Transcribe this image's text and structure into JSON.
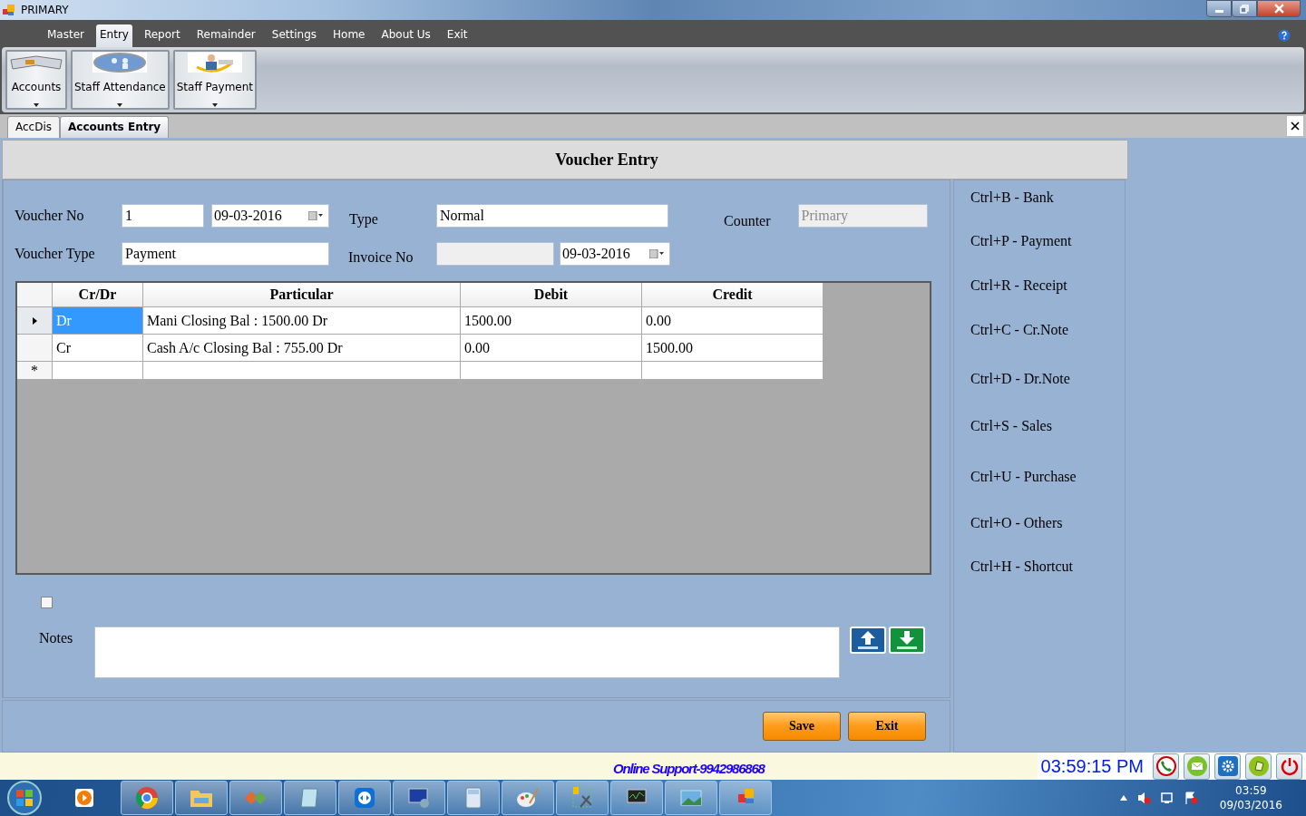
{
  "window": {
    "title": "PRIMARY"
  },
  "menu": [
    {
      "label": "Master",
      "selected": false
    },
    {
      "label": "Entry",
      "selected": true
    },
    {
      "label": "Report",
      "selected": false
    },
    {
      "label": "Remainder",
      "selected": false
    },
    {
      "label": "Settings",
      "selected": false
    },
    {
      "label": "Home",
      "selected": false
    },
    {
      "label": "About Us",
      "selected": false
    },
    {
      "label": "Exit",
      "selected": false
    }
  ],
  "ribbon": [
    {
      "label": "Accounts",
      "kind": "book"
    },
    {
      "label": "Staff Attendance",
      "kind": "people"
    },
    {
      "label": "Staff Payment",
      "kind": "worker"
    }
  ],
  "doc_tabs": [
    {
      "label": "AccDis",
      "selected": false
    },
    {
      "label": "Accounts Entry",
      "selected": true
    }
  ],
  "form": {
    "heading": "Voucher Entry",
    "voucher_no_label": "Voucher No",
    "voucher_no": "1",
    "voucher_date": "09-03-2016",
    "type_label": "Type",
    "type": "Normal",
    "counter_label": "Counter",
    "counter": {
      "value": "Primary",
      "disabled": true
    },
    "voucher_type_label": "Voucher Type",
    "voucher_type": "Payment",
    "invoice_no_label": "Invoice No",
    "invoice_no": {
      "disabled": true
    },
    "invoice_date": "09-03-2016"
  },
  "grid": {
    "columns": [
      "Cr/Dr",
      "Particular",
      "Debit",
      "Credit"
    ],
    "rows": [
      {
        "current": true,
        "selected": true,
        "cells": [
          "Dr",
          "Mani Closing Bal : 1500.00 Dr",
          "1500.00",
          "0.00"
        ]
      },
      {
        "current": false,
        "selected": false,
        "cells": [
          "Cr",
          "Cash A/c Closing Bal : 755.00 Dr",
          "0.00",
          "1500.00"
        ]
      }
    ],
    "new_row_marker": "*"
  },
  "checkbox": {
    "checked": false
  },
  "notes": {
    "label": "Notes"
  },
  "buttons": [
    "Save",
    "Exit"
  ],
  "shortcuts": [
    "Ctrl+B - Bank",
    "Ctrl+P - Payment",
    "Ctrl+R - Receipt",
    "Ctrl+C - Cr.Note",
    "Ctrl+D - Dr.Note",
    "Ctrl+S - Sales",
    "Ctrl+U - Purchase",
    "Ctrl+O - Others",
    "Ctrl+H - Shortcut"
  ],
  "status": {
    "support": "Online Support-9942986868",
    "clock": "03:59:15 PM"
  },
  "taskbar": {
    "time": "03:59",
    "date": "09/03/2016"
  }
}
